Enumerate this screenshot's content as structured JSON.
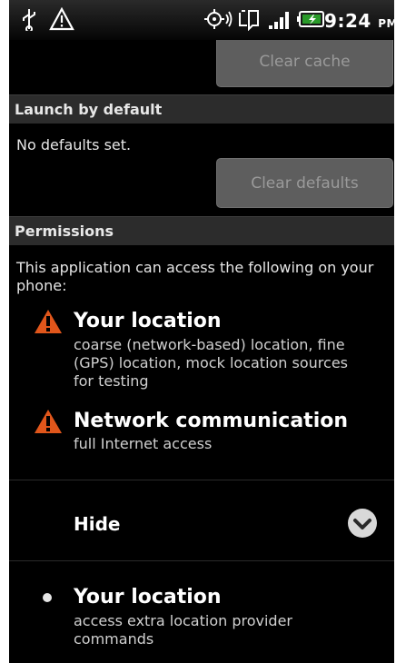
{
  "statusbar": {
    "time": "9:24",
    "ampm": "PM",
    "icons": [
      "usb-icon",
      "warning-icon",
      "gps-icon",
      "sync-icon",
      "signal-icon",
      "battery-icon"
    ]
  },
  "storage": {
    "clear_cache_label": "Clear cache"
  },
  "launch": {
    "header": "Launch by default",
    "status": "No defaults set.",
    "clear_defaults_label": "Clear defaults"
  },
  "permissions": {
    "header": "Permissions",
    "intro": "This application can access the following on your phone:",
    "items": [
      {
        "title": "Your location",
        "desc": "coarse (network-based) location, fine (GPS) location, mock location sources for testing"
      },
      {
        "title": "Network communication",
        "desc": "full Internet access"
      }
    ],
    "hide_label": "Hide",
    "hidden_items": [
      {
        "title": "Your location",
        "desc": "access extra location provider commands"
      }
    ]
  },
  "colors": {
    "warning": "#e0561b",
    "background": "#000000",
    "header": "#2c2c2c",
    "button": "#5e5e5e"
  }
}
